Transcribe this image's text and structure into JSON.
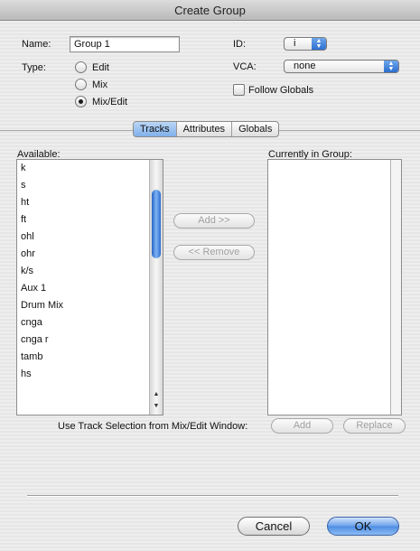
{
  "window": {
    "title": "Create Group"
  },
  "name": {
    "label": "Name:",
    "value": "Group 1"
  },
  "id": {
    "label": "ID:",
    "value": "i"
  },
  "vca": {
    "label": "VCA:",
    "value": "none"
  },
  "follow_globals": {
    "label": "Follow Globals",
    "checked": false
  },
  "type": {
    "label": "Type:",
    "options": [
      "Edit",
      "Mix",
      "Mix/Edit"
    ],
    "selected": "Mix/Edit"
  },
  "tabs": {
    "items": [
      "Tracks",
      "Attributes",
      "Globals"
    ],
    "active": "Tracks"
  },
  "available": {
    "label": "Available:",
    "items": [
      "k",
      "s",
      "ht",
      "ft",
      "ohl",
      "ohr",
      "k/s",
      "Aux 1",
      "Drum Mix",
      "cnga",
      "cnga r",
      "tamb",
      "hs"
    ]
  },
  "current": {
    "label": "Currently in Group:",
    "items": []
  },
  "buttons": {
    "add": "Add >>",
    "remove": "<< Remove",
    "sel_add": "Add",
    "sel_replace": "Replace",
    "cancel": "Cancel",
    "ok": "OK"
  },
  "selection_label": "Use Track Selection from Mix/Edit Window:",
  "icons": {
    "popup": "up-down-arrows-icon",
    "scroll_up": "triangle-up-icon",
    "scroll_down": "triangle-down-icon"
  },
  "colors": {
    "accent": "#4d8ce4"
  }
}
